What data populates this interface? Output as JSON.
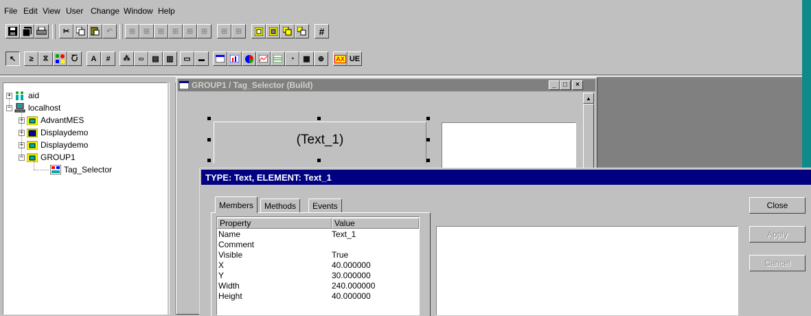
{
  "menu": [
    "File",
    "Edit",
    "View",
    "User",
    "Change",
    "Window",
    "Help"
  ],
  "toolbar2_labels": {
    "text_a": "A",
    "hash": "#",
    "ax": "AX",
    "ue": "UE"
  },
  "tree": {
    "root": "aid",
    "host": "localhost",
    "children": [
      "AdvantMES",
      "Displaydemo",
      "Displaydemo",
      "GROUP1"
    ],
    "leaf": "Tag_Selector"
  },
  "build_window": {
    "title": "GROUP1 / Tag_Selector (Build)",
    "text_element": "(Text_1)"
  },
  "dialog": {
    "title": "TYPE: Text,  ELEMENT: Text_1",
    "tabs": [
      "Members",
      "Methods",
      "Events"
    ],
    "columns": [
      "Property",
      "Value"
    ],
    "rows": [
      {
        "property": "Name",
        "value": "Text_1"
      },
      {
        "property": "Comment",
        "value": ""
      },
      {
        "property": "Visible",
        "value": "True"
      },
      {
        "property": "X",
        "value": "40.000000"
      },
      {
        "property": "Y",
        "value": "30.000000"
      },
      {
        "property": "Width",
        "value": "240.000000"
      },
      {
        "property": "Height",
        "value": "40.000000"
      }
    ],
    "buttons": {
      "close": "Close",
      "apply": "Apply",
      "cancel": "Cancel"
    }
  },
  "colors": {
    "title_active": "#000080",
    "title_inactive": "#808080",
    "desktop_teal": "#0f8a8a",
    "face": "#c0c0c0"
  }
}
